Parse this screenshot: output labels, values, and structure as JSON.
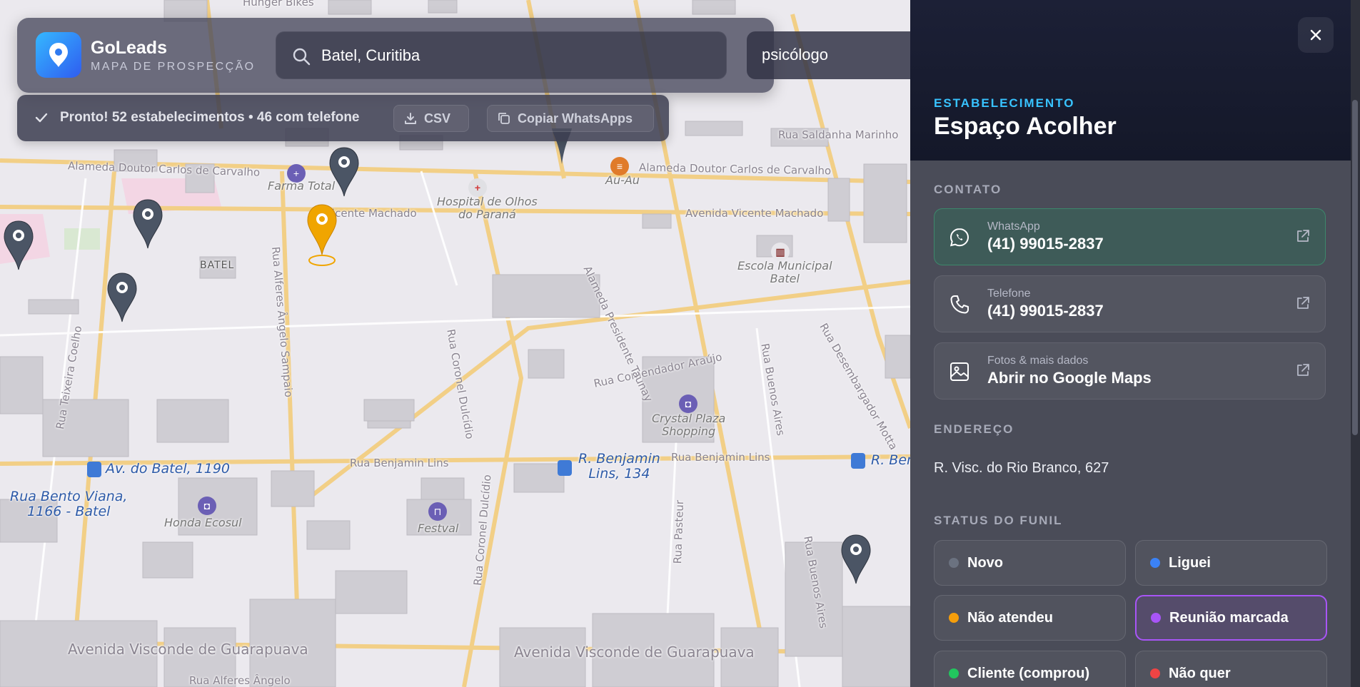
{
  "app": {
    "name": "GoLeads",
    "subtitle": "MAPA DE PROSPECÇÃO"
  },
  "search": {
    "location": "Batel, Curitiba",
    "niche": "psicólogo"
  },
  "status": {
    "text": "Pronto! 52 estabelecimentos • 46 com telefone",
    "csv_label": "CSV",
    "copy_whatsapp_label": "Copiar WhatsApps"
  },
  "map": {
    "labels": {
      "farma": "Farma Total",
      "hospital": "Hospital de Olhos\ndo Paraná",
      "auau": "Au-Au",
      "escola": "Escola Municipal\nBatel",
      "crystal": "Crystal Plaza\nShopping",
      "batel": "BATEL",
      "honda": "Honda Ecosul",
      "festval": "Festval",
      "bus1": "Av. do Batel, 1190",
      "bus2": "R. Benjamin\nLins, 134",
      "bus3": "R. Benj",
      "bus4": "Rua Bento Viana,\n1166 - Batel",
      "rua_benjamin_1": "Rua Benjamin Lins",
      "rua_benjamin_2": "Rua Benjamin Lins",
      "av_visconde_1": "Avenida Visconde de Guarapuava",
      "av_visconde_2": "Avenida Visconde de Guarapuava",
      "rua_alferes": "Rua Alferes Ângelo",
      "rua_comendador": "Rua Comendador Araújo",
      "av_vicente": "Avenida Vicente Machado",
      "vicente_machado": "Vicente Machado",
      "av_vicente_2": "Avenida Vicente Machado",
      "al_doutor": "Alameda Doutor Carlos de Carvalho",
      "al_doutor_left": "Alameda Doutor Carlos de Carvalho",
      "rua_saldanha": "Rua Saldanha Marinho",
      "rua_coronel": "Rua Coronel Dulcídio",
      "rua_coronel_2": "Rua Coronel Dulcídio",
      "rua_pasteur": "Rua Pasteur",
      "rua_buenos": "Rua Buenos Aires",
      "rua_buenos_2": "Rua Buenos Aires",
      "al_taunay": "Alameda Presidente Taunay",
      "rua_desembargador": "Rua Desembargador Motta",
      "rua_teixeira": "Rua Teixeira Coelho",
      "rua_alferes_2": "Rua Alferes Ângelo Sampaio",
      "rua_coelho": "Rua Teixeira Coelho",
      "hunger": "Hunger Bikes"
    }
  },
  "panel": {
    "section_label": "ESTABELECIMENTO",
    "name": "Espaço Acolher",
    "contact_label": "CONTATO",
    "contacts": [
      {
        "label": "WhatsApp",
        "value": "(41) 99015-2837",
        "icon": "whatsapp-icon"
      },
      {
        "label": "Telefone",
        "value": "(41) 99015-2837",
        "icon": "phone-icon"
      },
      {
        "label": "Fotos & mais dados",
        "value": "Abrir no Google Maps",
        "icon": "image-icon"
      }
    ],
    "address_label": "ENDEREÇO",
    "address": "R. Visc. do Rio Branco, 627",
    "funnel_label": "STATUS DO FUNIL",
    "funnel": [
      {
        "label": "Novo",
        "color": "#6b7280",
        "active": false
      },
      {
        "label": "Liguei",
        "color": "#3b82f6",
        "active": false
      },
      {
        "label": "Não atendeu",
        "color": "#f59e0b",
        "active": false
      },
      {
        "label": "Reunião marcada",
        "color": "#a855f7",
        "active": true
      },
      {
        "label": "Cliente (comprou)",
        "color": "#22c55e",
        "active": false
      },
      {
        "label": "Não quer",
        "color": "#ef4444",
        "active": false
      }
    ]
  },
  "colors": {
    "accent": "#38c3ff",
    "selected_pin": "#f0a500",
    "pin": "#4b5565"
  }
}
